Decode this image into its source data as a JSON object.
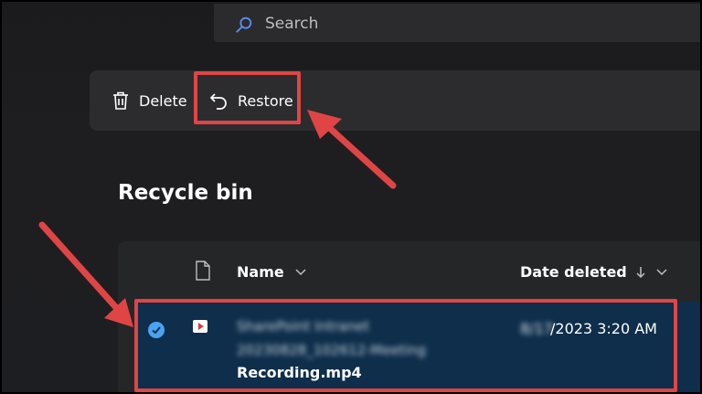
{
  "search": {
    "placeholder": "Search"
  },
  "toolbar": {
    "delete_label": "Delete",
    "restore_label": "Restore"
  },
  "page": {
    "title": "Recycle bin"
  },
  "list": {
    "columns": [
      "Name",
      "Date deleted"
    ],
    "rows": [
      {
        "blurred_line_1": "SharePoint Intranet",
        "blurred_line_2": "20230828_102612-Meeting",
        "file_name": "Recording.mp4",
        "date_hidden_part": "8/17",
        "date_visible_part": "/2023 3:20 AM",
        "selected": true
      }
    ]
  },
  "colors": {
    "highlight": "#e04545",
    "selected_row": "#0e2e4b",
    "accent": "#4aa3f0"
  },
  "icons": [
    "search-icon",
    "trash-icon",
    "restore-icon",
    "file-icon",
    "video-file-icon",
    "checkmark-icon",
    "chevron-down-icon",
    "sort-down-arrow-icon"
  ]
}
